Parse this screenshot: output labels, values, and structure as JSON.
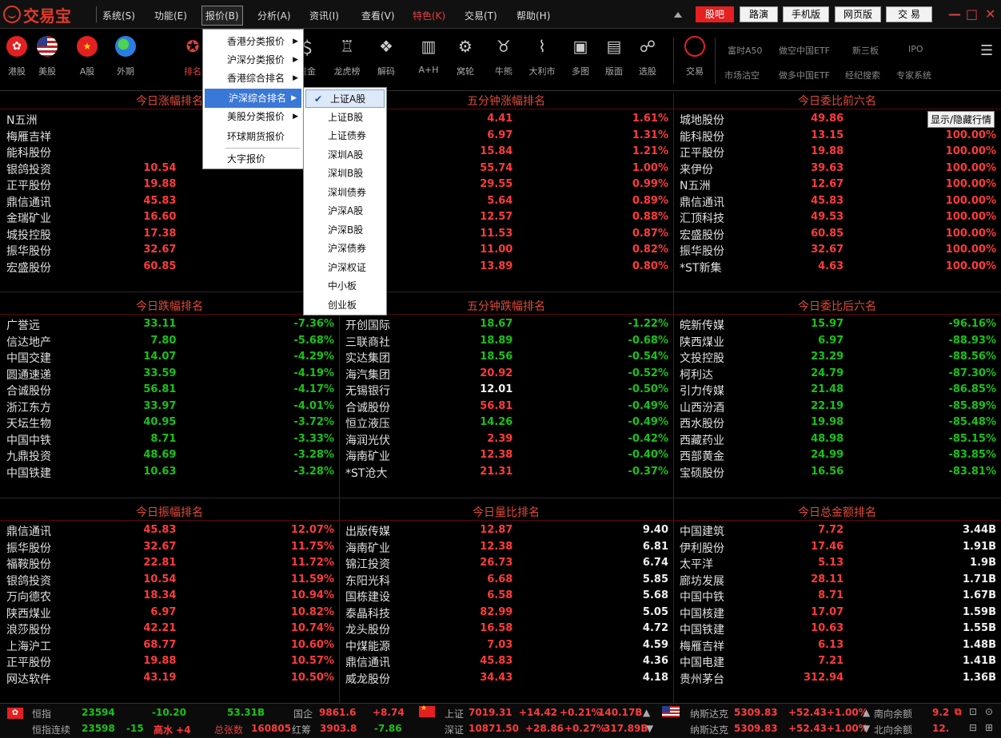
{
  "app": {
    "name": "交易宝"
  },
  "menubar": {
    "items": [
      "系统(S)",
      "功能(E)",
      "报价(B)",
      "分析(A)",
      "资讯(I)",
      "查看(V)",
      "特色(K)",
      "交易(T)",
      "帮助(H)"
    ],
    "active_item": "报价(B)",
    "right_buttons": {
      "guba": "股吧",
      "roadshow": "路演",
      "mobile": "手机版",
      "web": "网页版",
      "trade": "交 易"
    }
  },
  "toolbar": {
    "buttons": [
      {
        "label": "港股",
        "icon": "hk-flag-icon"
      },
      {
        "label": "美股",
        "icon": "us-flag-icon"
      },
      {
        "label": "A股",
        "icon": "cn-flag-icon"
      },
      {
        "label": "外期",
        "icon": "globe-icon"
      },
      {
        "label": "排名",
        "icon": "ranking-icon"
      },
      {
        "label": "资金",
        "icon": "money-icon"
      },
      {
        "label": "龙虎榜",
        "icon": "trophy-icon"
      },
      {
        "label": "解码",
        "icon": "decode-icon"
      },
      {
        "label": "A+H",
        "icon": "ah-icon"
      },
      {
        "label": "窝轮",
        "icon": "warrant-icon"
      },
      {
        "label": "牛熊",
        "icon": "bull-bear-icon"
      },
      {
        "label": "大利市",
        "icon": "chart-icon"
      },
      {
        "label": "多图",
        "icon": "multi-chart-icon"
      },
      {
        "label": "版面",
        "icon": "layout-icon"
      },
      {
        "label": "选股",
        "icon": "stock-picker-icon"
      },
      {
        "label": "交易",
        "icon": "trade-icon"
      }
    ],
    "quick_links_row1": [
      "富时A50",
      "做空中国ETF",
      "新三板",
      "IPO"
    ],
    "quick_links_row2": [
      "市场沽空",
      "做多中国ETF",
      "经纪搜索",
      "专家系统"
    ]
  },
  "dropdown_primary": {
    "items": [
      {
        "label": "香港分类报价",
        "submenu": true
      },
      {
        "label": "沪深分类报价",
        "submenu": true
      },
      {
        "label": "香港综合排名",
        "submenu": true
      },
      {
        "label": "沪深综合排名",
        "submenu": true,
        "selected": true
      },
      {
        "label": "美股分类报价",
        "submenu": true
      },
      {
        "label": "环球期货报价",
        "submenu": false
      },
      {
        "label": "大字报价",
        "submenu": false
      }
    ],
    "arrow": "▶"
  },
  "dropdown_secondary": {
    "items": [
      "上证A股",
      "上证B股",
      "上证债券",
      "深圳A股",
      "深圳B股",
      "深圳债券",
      "沪深A股",
      "沪深B股",
      "沪深债券",
      "沪深权证",
      "中小板",
      "创业板"
    ],
    "checked": "上证A股",
    "check_mark": "✔"
  },
  "tooltip": "显示/隐藏行情",
  "panels": {
    "rise": {
      "title": "今日涨幅排名",
      "rows": [
        {
          "name": "N五洲",
          "price": "",
          "value": "1"
        },
        {
          "name": "梅雁吉祥",
          "price": "",
          "value": ""
        },
        {
          "name": "能科股份",
          "price": "",
          "value": "1"
        },
        {
          "name": "银鸽投资",
          "price": "10.54",
          "value": "1"
        },
        {
          "name": "正平股份",
          "price": "19.88",
          "value": "1"
        },
        {
          "name": "鼎信通讯",
          "price": "45.83",
          "value": "1"
        },
        {
          "name": "金瑞矿业",
          "price": "16.60",
          "value": "1"
        },
        {
          "name": "城投控股",
          "price": "17.38",
          "value": "1"
        },
        {
          "name": "振华股份",
          "price": "32.67",
          "value": "1"
        },
        {
          "name": "宏盛股份",
          "price": "60.85",
          "value": "1"
        }
      ]
    },
    "five_rise": {
      "title": "五分钟涨幅排名",
      "rows": [
        {
          "name": "份",
          "price": "4.41",
          "value": "1.61%"
        },
        {
          "name": "业",
          "price": "6.97",
          "value": "1.31%"
        },
        {
          "name": "药",
          "price": "15.84",
          "value": "1.21%"
        },
        {
          "name": "虹",
          "price": "55.74",
          "value": "1.00%"
        },
        {
          "name": "团",
          "price": "29.55",
          "value": "0.99%"
        },
        {
          "name": "电",
          "price": "5.64",
          "value": "0.89%"
        },
        {
          "name": "媒",
          "price": "12.57",
          "value": "0.88%"
        },
        {
          "name": "份",
          "price": "11.53",
          "value": "0.87%"
        },
        {
          "name": "装",
          "price": "11.00",
          "value": "0.82%"
        },
        {
          "name": "技",
          "price": "13.89",
          "value": "0.80%"
        }
      ]
    },
    "bid_top": {
      "title": "今日委比前六名",
      "rows": [
        {
          "name": "城地股份",
          "price": "49.86",
          "value": ""
        },
        {
          "name": "能科股份",
          "price": "13.15",
          "value": "100.00%"
        },
        {
          "name": "正平股份",
          "price": "19.88",
          "value": "100.00%"
        },
        {
          "name": "来伊份",
          "price": "39.63",
          "value": "100.00%"
        },
        {
          "name": "N五洲",
          "price": "12.67",
          "value": "100.00%"
        },
        {
          "name": "鼎信通讯",
          "price": "45.83",
          "value": "100.00%"
        },
        {
          "name": "汇顶科技",
          "price": "49.53",
          "value": "100.00%"
        },
        {
          "name": "宏盛股份",
          "price": "60.85",
          "value": "100.00%"
        },
        {
          "name": "振华股份",
          "price": "32.67",
          "value": "100.00%"
        },
        {
          "name": "*ST新集",
          "price": "4.63",
          "value": "100.00%"
        }
      ]
    },
    "fall": {
      "title": "今日跌幅排名",
      "rows": [
        {
          "name": "广誉远",
          "price": "33.11",
          "value": "-7.36%"
        },
        {
          "name": "信达地产",
          "price": "7.80",
          "value": "-5.68%"
        },
        {
          "name": "中国交建",
          "price": "14.07",
          "value": "-4.29%"
        },
        {
          "name": "圆通速递",
          "price": "33.59",
          "value": "-4.19%"
        },
        {
          "name": "合诚股份",
          "price": "56.81",
          "value": "-4.17%"
        },
        {
          "name": "浙江东方",
          "price": "33.97",
          "value": "-4.01%"
        },
        {
          "name": "天坛生物",
          "price": "40.95",
          "value": "-3.72%"
        },
        {
          "name": "中国中铁",
          "price": "8.71",
          "value": "-3.33%"
        },
        {
          "name": "九鼎投资",
          "price": "48.69",
          "value": "-3.28%"
        },
        {
          "name": "中国铁建",
          "price": "10.63",
          "value": "-3.28%"
        }
      ]
    },
    "five_fall": {
      "title": "五分钟跌幅排名",
      "rows": [
        {
          "name": "开创国际",
          "price": "18.67",
          "value": "-1.22%",
          "pc": "green"
        },
        {
          "name": "三联商社",
          "price": "18.89",
          "value": "-0.68%",
          "pc": "green"
        },
        {
          "name": "实达集团",
          "price": "18.56",
          "value": "-0.54%",
          "pc": "green"
        },
        {
          "name": "海汽集团",
          "price": "20.92",
          "value": "-0.52%",
          "pc": "red"
        },
        {
          "name": "无锡银行",
          "price": "12.01",
          "value": "-0.50%",
          "pc": "white"
        },
        {
          "name": "合诚股份",
          "price": "56.81",
          "value": "-0.49%",
          "pc": "red"
        },
        {
          "name": "恒立液压",
          "price": "14.26",
          "value": "-0.49%",
          "pc": "green"
        },
        {
          "name": "海润光伏",
          "price": "2.39",
          "value": "-0.42%",
          "pc": "red"
        },
        {
          "name": "海南矿业",
          "price": "12.38",
          "value": "-0.40%",
          "pc": "red"
        },
        {
          "name": "*ST沧大",
          "price": "21.31",
          "value": "-0.37%",
          "pc": "red"
        }
      ]
    },
    "bid_bottom": {
      "title": "今日委比后六名",
      "rows": [
        {
          "name": "皖新传媒",
          "price": "15.97",
          "value": "-96.16%"
        },
        {
          "name": "陕西煤业",
          "price": "6.97",
          "value": "-88.93%"
        },
        {
          "name": "文投控股",
          "price": "23.29",
          "value": "-88.56%"
        },
        {
          "name": "柯利达",
          "price": "24.79",
          "value": "-87.30%"
        },
        {
          "name": "引力传媒",
          "price": "21.48",
          "value": "-86.85%"
        },
        {
          "name": "山西汾酒",
          "price": "22.19",
          "value": "-85.89%"
        },
        {
          "name": "西水股份",
          "price": "19.98",
          "value": "-85.48%"
        },
        {
          "name": "西藏药业",
          "price": "48.98",
          "value": "-85.15%"
        },
        {
          "name": "西部黄金",
          "price": "24.99",
          "value": "-83.85%"
        },
        {
          "name": "宝硕股份",
          "price": "16.56",
          "value": "-83.81%"
        }
      ]
    },
    "amplitude": {
      "title": "今日振幅排名",
      "rows": [
        {
          "name": "鼎信通讯",
          "price": "45.83",
          "value": "12.07%"
        },
        {
          "name": "振华股份",
          "price": "32.67",
          "value": "11.75%"
        },
        {
          "name": "福鞍股份",
          "price": "22.81",
          "value": "11.72%"
        },
        {
          "name": "银鸽投资",
          "price": "10.54",
          "value": "11.59%"
        },
        {
          "name": "万向德农",
          "price": "18.34",
          "value": "10.94%"
        },
        {
          "name": "陕西煤业",
          "price": "6.97",
          "value": "10.82%"
        },
        {
          "name": "浪莎股份",
          "price": "42.21",
          "value": "10.74%"
        },
        {
          "name": "上海沪工",
          "price": "68.77",
          "value": "10.60%"
        },
        {
          "name": "正平股份",
          "price": "19.88",
          "value": "10.57%"
        },
        {
          "name": "网达软件",
          "price": "43.19",
          "value": "10.50%"
        }
      ]
    },
    "volume_ratio": {
      "title": "今日量比排名",
      "rows": [
        {
          "name": "出版传媒",
          "price": "12.87",
          "value": "9.40"
        },
        {
          "name": "海南矿业",
          "price": "12.38",
          "value": "6.81"
        },
        {
          "name": "锦江投资",
          "price": "26.73",
          "value": "6.74"
        },
        {
          "name": "东阳光科",
          "price": "6.68",
          "value": "5.85"
        },
        {
          "name": "国栋建设",
          "price": "6.58",
          "value": "5.68"
        },
        {
          "name": "泰晶科技",
          "price": "82.99",
          "value": "5.05"
        },
        {
          "name": "龙头股份",
          "price": "16.58",
          "value": "4.72"
        },
        {
          "name": "中煤能源",
          "price": "7.03",
          "value": "4.59"
        },
        {
          "name": "鼎信通讯",
          "price": "45.83",
          "value": "4.36"
        },
        {
          "name": "威龙股份",
          "price": "34.43",
          "value": "4.18"
        }
      ]
    },
    "turnover": {
      "title": "今日总金额排名",
      "rows": [
        {
          "name": "中国建筑",
          "price": "7.72",
          "value": "3.44B"
        },
        {
          "name": "伊利股份",
          "price": "17.46",
          "value": "1.91B"
        },
        {
          "name": "太平洋",
          "price": "5.13",
          "value": "1.9B"
        },
        {
          "name": "廊坊发展",
          "price": "28.11",
          "value": "1.71B"
        },
        {
          "name": "中国中铁",
          "price": "8.71",
          "value": "1.67B"
        },
        {
          "name": "中国核建",
          "price": "17.07",
          "value": "1.59B"
        },
        {
          "name": "中国铁建",
          "price": "10.63",
          "value": "1.55B"
        },
        {
          "name": "梅雁吉祥",
          "price": "6.13",
          "value": "1.48B"
        },
        {
          "name": "中国电建",
          "price": "7.21",
          "value": "1.41B"
        },
        {
          "name": "贵州茅台",
          "price": "312.94",
          "value": "1.36B"
        }
      ]
    }
  },
  "ticker": {
    "line1": {
      "hsi_label": "恒指",
      "hsi": "23594",
      "hsi_chg": "-10.20",
      "hsi_amt": "53.31B",
      "gq_label": "国企",
      "gq": "9861.6",
      "gq_chg": "+8.74",
      "sh_label": "上证",
      "sh": "7019.31",
      "sh_chg": "+14.42",
      "sh_pct": "+0.21%",
      "sh_amt": "140.17B",
      "nasdaq_label": "纳斯达克",
      "nasdaq": "5309.83",
      "nasdaq_chg": "+52.43",
      "nasdaq_pct": "+1.00%",
      "south_label": "南向余额",
      "south": "9.2"
    },
    "line2": {
      "cont_label": "恒指连续",
      "cont": "23598",
      "cont_chg": "-15",
      "premium": "高水 +4",
      "total_label": "总张数",
      "total": "160805",
      "red_label": "红筹",
      "red": "3903.8",
      "red_chg": "-7.86",
      "sz_label": "深证",
      "sz": "10871.50",
      "sz_chg": "+28.86",
      "sz_pct": "+0.27%",
      "sz_amt": "317.89B",
      "nasdaq_label": "纳斯达克",
      "nasdaq": "5309.83",
      "nasdaq_chg": "+52.43",
      "nasdaq_pct": "+1.00%",
      "north_label": "北向余额",
      "north": "12."
    }
  }
}
